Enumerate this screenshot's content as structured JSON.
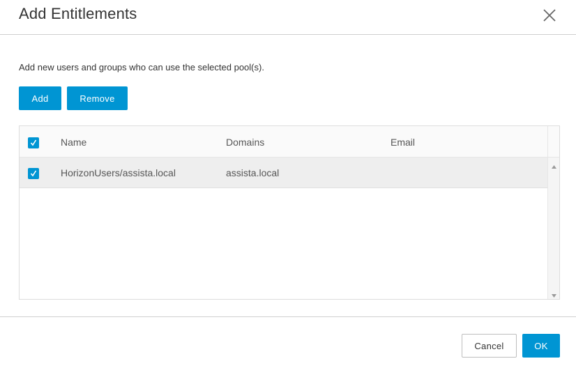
{
  "dialog": {
    "title": "Add Entitlements",
    "close_icon": "close-icon",
    "description": "Add new users and groups who can use the selected pool(s).",
    "toolbar": {
      "add_label": "Add",
      "remove_label": "Remove"
    },
    "grid": {
      "select_all_checked": true,
      "columns": [
        "Name",
        "Domains",
        "Email"
      ],
      "rows": [
        {
          "checked": true,
          "name": "HorizonUsers/assista.local",
          "domains": "assista.local",
          "email": ""
        }
      ]
    },
    "footer": {
      "cancel_label": "Cancel",
      "ok_label": "OK"
    }
  },
  "colors": {
    "accent": "#0095d3",
    "row_highlight": "#eeeeee",
    "border": "#dddddd"
  }
}
